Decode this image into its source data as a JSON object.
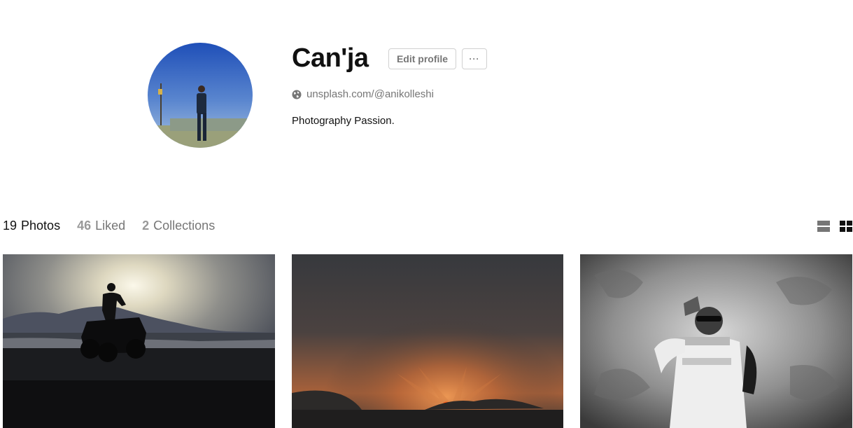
{
  "profile": {
    "name": "Can'ja",
    "edit_label": "Edit profile",
    "more_label": "···",
    "link": "unsplash.com/@anikolleshi",
    "bio": "Photography Passion."
  },
  "tabs": [
    {
      "count": "19",
      "label": "Photos",
      "active": true
    },
    {
      "count": "46",
      "label": "Liked",
      "active": false
    },
    {
      "count": "2",
      "label": "Collections",
      "active": false
    }
  ],
  "colors": {
    "text_primary": "#111111",
    "text_muted": "#767676",
    "border": "#d1d1d1",
    "view_list_icon": "#767676",
    "view_grid_icon": "#111111"
  },
  "icons": {
    "link": "globe-icon",
    "view_list": "list-view-icon",
    "view_grid": "grid-view-icon"
  }
}
